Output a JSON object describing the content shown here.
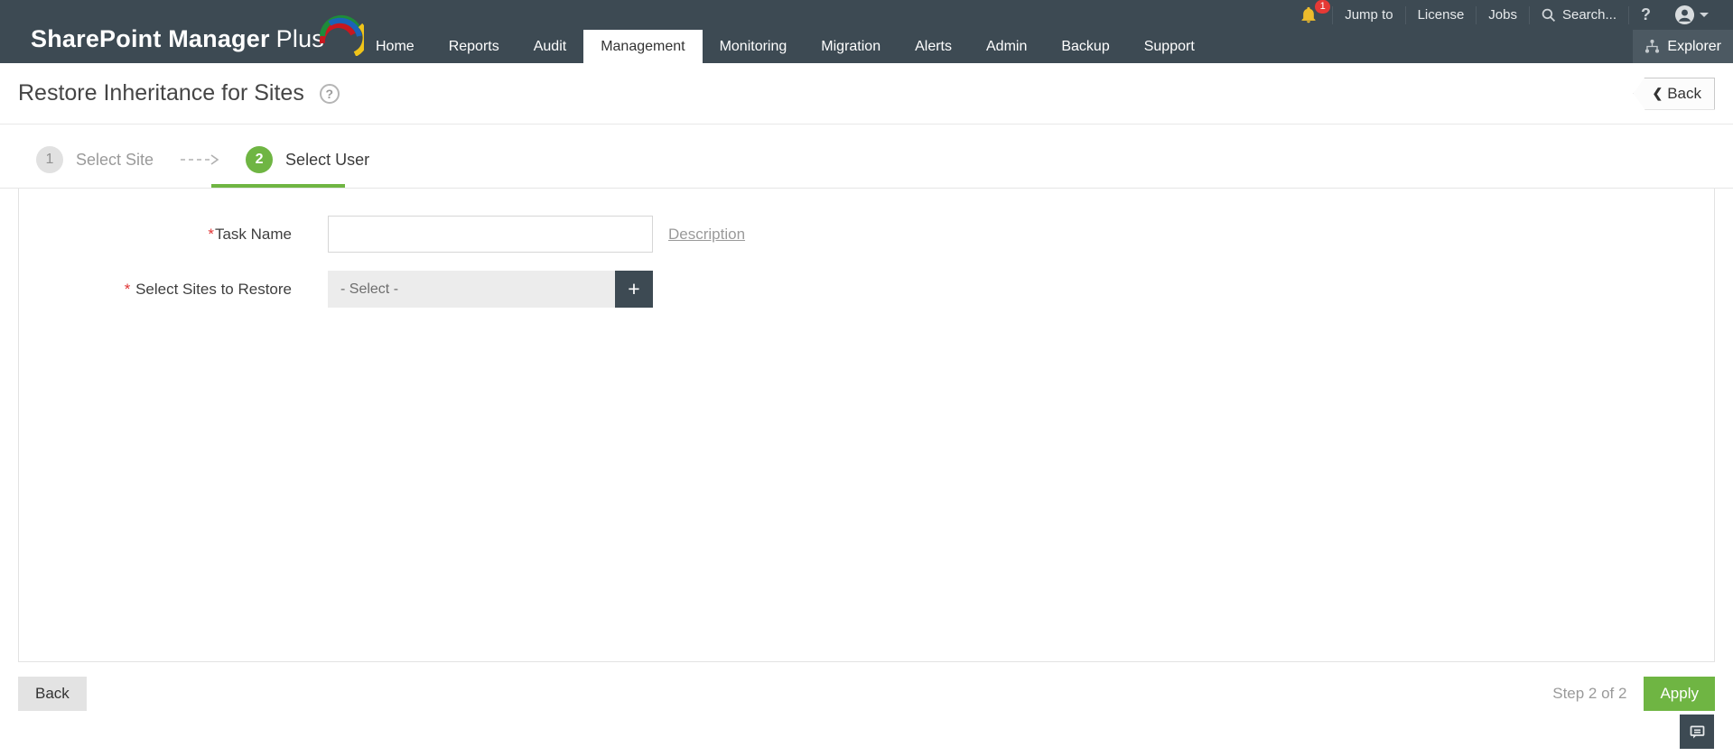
{
  "header": {
    "logo": {
      "text_main": "SharePoint Manager",
      "text_accent": "Plus"
    },
    "utility": {
      "notification_count": "1",
      "jump_to": "Jump to",
      "license": "License",
      "jobs": "Jobs",
      "search_label": "Search...",
      "help_label": "?",
      "icons": [
        "bell-icon",
        "search-icon",
        "user-avatar-icon",
        "chevron-down-icon"
      ]
    },
    "nav": {
      "items": [
        {
          "label": "Home",
          "active": false
        },
        {
          "label": "Reports",
          "active": false
        },
        {
          "label": "Audit",
          "active": false
        },
        {
          "label": "Management",
          "active": true
        },
        {
          "label": "Monitoring",
          "active": false
        },
        {
          "label": "Migration",
          "active": false
        },
        {
          "label": "Alerts",
          "active": false
        },
        {
          "label": "Admin",
          "active": false
        },
        {
          "label": "Backup",
          "active": false
        },
        {
          "label": "Support",
          "active": false
        }
      ],
      "explorer_label": "Explorer",
      "explorer_icon": "sitemap-icon"
    }
  },
  "page": {
    "title": "Restore Inheritance for Sites",
    "help_icon": "question-circle-icon",
    "back_button_label": "Back",
    "back_chevron": "❮"
  },
  "wizard": {
    "steps": [
      {
        "number": "1",
        "label": "Select Site",
        "state": "inactive"
      },
      {
        "number": "2",
        "label": "Select User",
        "state": "active"
      }
    ],
    "connector_icon": "dashed-arrow-icon"
  },
  "form": {
    "task_name": {
      "required_mark": "*",
      "label": "Task Name",
      "value": "",
      "description_link": "Description"
    },
    "select_sites": {
      "required_mark": "*",
      "label": "Select Sites to Restore",
      "selected_value": "- Select -",
      "add_button_label": "+"
    }
  },
  "footer": {
    "back_label": "Back",
    "step_indicator": "Step 2 of 2",
    "apply_label": "Apply",
    "chat_icon": "feedback-chat-icon"
  },
  "colors": {
    "header_bg": "#3d4a53",
    "explorer_bg": "#4c5962",
    "accent_green": "#6fb543",
    "badge_red": "#e53935",
    "bell_gold": "#eebc2c",
    "border_gray": "#e2e2e2",
    "select_bg": "#ececec"
  }
}
